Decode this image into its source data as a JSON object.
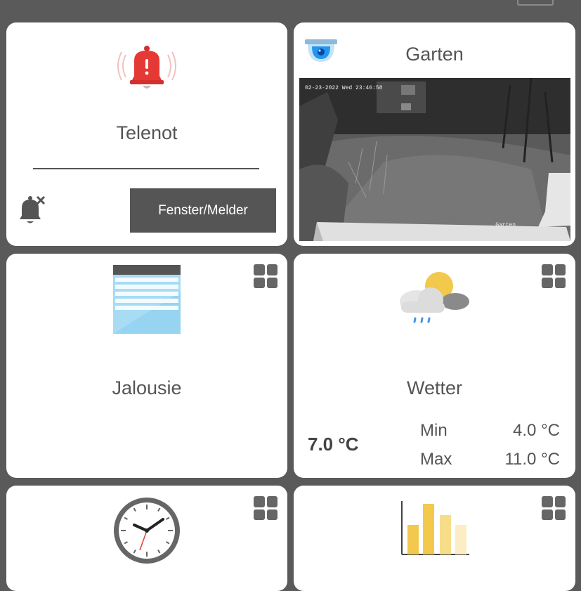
{
  "tiles": {
    "telenot": {
      "title": "Telenot",
      "button_label": "Fenster/Melder",
      "icon": "alarm-bell-icon",
      "mute_icon": "bell-mute-icon"
    },
    "garten": {
      "title": "Garten",
      "icon": "dome-camera-icon",
      "camera": {
        "timestamp": "02-23-2022 Wed 23:46:58",
        "label": "Garten"
      }
    },
    "jalousie": {
      "title": "Jalousie",
      "icon": "blind-icon"
    },
    "wetter": {
      "title": "Wetter",
      "icon": "weather-cloud-sun-rain-icon",
      "current_temp": "7.0 °C",
      "min_label": "Min",
      "min_value": "4.0 °C",
      "max_label": "Max",
      "max_value": "11.0 °C"
    },
    "clock": {
      "icon": "clock-icon"
    },
    "chart": {
      "icon": "bar-chart-icon"
    }
  },
  "colors": {
    "background": "#5a5a5a",
    "tile": "#ffffff",
    "alarm_red": "#e53935",
    "button_dark": "#555555",
    "sun_yellow": "#f2c94c",
    "blind_blue": "#a8dcf5"
  }
}
